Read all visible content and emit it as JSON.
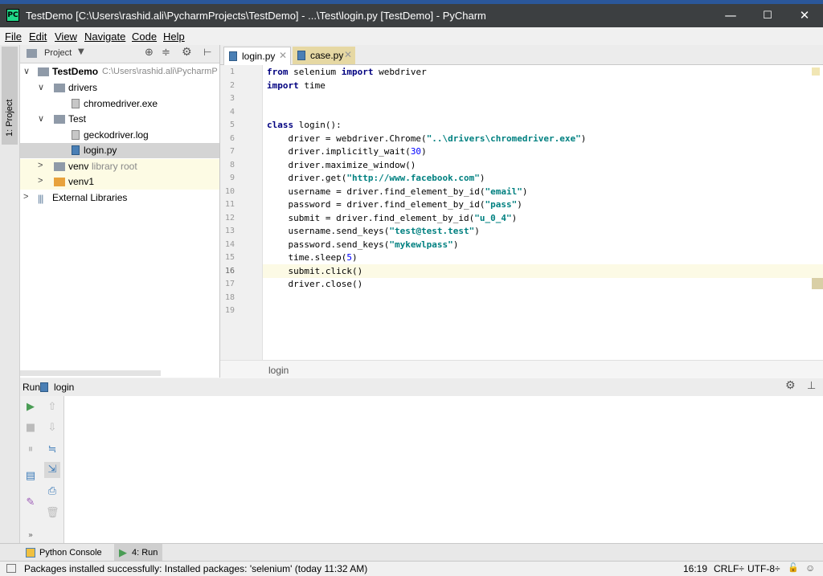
{
  "window": {
    "title": "TestDemo [C:\\Users\\rashid.ali\\PycharmProjects\\TestDemo] - ...\\Test\\login.py [TestDemo] - PyCharm",
    "app_icon_label": "PC",
    "minimize": "—",
    "maximize": "☐",
    "close": "✕"
  },
  "menu": [
    {
      "label": "File"
    },
    {
      "label": "Edit"
    },
    {
      "label": "View"
    },
    {
      "label": "Navigate"
    },
    {
      "label": "Code"
    },
    {
      "label": "Help"
    }
  ],
  "sidebar": {
    "vertical_tab": "1: Project"
  },
  "project_panel": {
    "header_label": "Project",
    "tree": [
      {
        "label": "TestDemo",
        "extra": "C:\\Users\\rashid.ali\\PycharmP",
        "type": "folder",
        "expanded": true,
        "bold": true
      },
      {
        "label": "drivers",
        "extra": "",
        "type": "folder",
        "expanded": true
      },
      {
        "label": "chromedriver.exe",
        "extra": "",
        "type": "file"
      },
      {
        "label": "Test",
        "extra": "",
        "type": "folder",
        "expanded": true
      },
      {
        "label": "geckodriver.log",
        "extra": "",
        "type": "file"
      },
      {
        "label": "login.py",
        "extra": "",
        "type": "pyfile",
        "selected": true
      },
      {
        "label": "venv",
        "extra": "library root",
        "type": "folder",
        "expanded": false
      },
      {
        "label": "venv1",
        "extra": "",
        "type": "folder-orange",
        "expanded": false
      },
      {
        "label": "External Libraries",
        "extra": "",
        "type": "lib",
        "expanded": false
      }
    ]
  },
  "editor": {
    "tabs": [
      {
        "label": "login.py",
        "active": true
      },
      {
        "label": "case.py",
        "active": false
      }
    ],
    "lines": [
      [
        {
          "t": "from",
          "c": "kw"
        },
        {
          "t": " selenium ",
          "c": ""
        },
        {
          "t": "import",
          "c": "kw"
        },
        {
          "t": " webdriver",
          "c": ""
        }
      ],
      [
        {
          "t": "import",
          "c": "kw"
        },
        {
          "t": " time",
          "c": ""
        }
      ],
      [],
      [],
      [
        {
          "t": "class",
          "c": "kw"
        },
        {
          "t": " login():",
          "c": ""
        }
      ],
      [
        {
          "t": "    driver = webdriver.Chrome(",
          "c": ""
        },
        {
          "t": "\"..\\drivers\\chromedriver.exe\"",
          "c": "str"
        },
        {
          "t": ")",
          "c": ""
        }
      ],
      [
        {
          "t": "    driver.implicitly_wait(",
          "c": ""
        },
        {
          "t": "30",
          "c": "num"
        },
        {
          "t": ")",
          "c": ""
        }
      ],
      [
        {
          "t": "    driver.maximize_window()",
          "c": ""
        }
      ],
      [
        {
          "t": "    driver.get(",
          "c": ""
        },
        {
          "t": "\"http://www.facebook.com\"",
          "c": "str"
        },
        {
          "t": ")",
          "c": ""
        }
      ],
      [
        {
          "t": "    username = driver.find_element_by_id(",
          "c": ""
        },
        {
          "t": "\"email\"",
          "c": "str"
        },
        {
          "t": ")",
          "c": ""
        }
      ],
      [
        {
          "t": "    password = driver.find_element_by_id(",
          "c": ""
        },
        {
          "t": "\"pass\"",
          "c": "str"
        },
        {
          "t": ")",
          "c": ""
        }
      ],
      [
        {
          "t": "    submit = driver.find_element_by_id(",
          "c": ""
        },
        {
          "t": "\"u_0_4\"",
          "c": "str"
        },
        {
          "t": ")",
          "c": ""
        }
      ],
      [
        {
          "t": "    username.send_keys(",
          "c": ""
        },
        {
          "t": "\"test@test.test\"",
          "c": "str"
        },
        {
          "t": ")",
          "c": ""
        }
      ],
      [
        {
          "t": "    password.send_keys(",
          "c": ""
        },
        {
          "t": "\"mykewlpass\"",
          "c": "str"
        },
        {
          "t": ")",
          "c": ""
        }
      ],
      [
        {
          "t": "    time.sleep(",
          "c": ""
        },
        {
          "t": "5",
          "c": "num"
        },
        {
          "t": ")",
          "c": ""
        }
      ],
      [
        {
          "t": "    submit.click()",
          "c": ""
        }
      ],
      [
        {
          "t": "    driver.close()",
          "c": ""
        }
      ],
      [],
      []
    ],
    "breadcrumb": "login"
  },
  "run_panel": {
    "label": "Run",
    "config": "login"
  },
  "bottom_tabs": [
    {
      "label": "Python Console",
      "active": false
    },
    {
      "label": "4: Run",
      "active": true
    }
  ],
  "status": {
    "message": "Packages installed successfully: Installed packages: 'selenium' (today 11:32 AM)",
    "position": "16:19",
    "line_sep": "CRLF÷",
    "encoding": "UTF-8÷"
  },
  "colors": {
    "keyword": "#000080",
    "string": "#008080",
    "number": "#0000ff",
    "run_green": "#499c54"
  }
}
